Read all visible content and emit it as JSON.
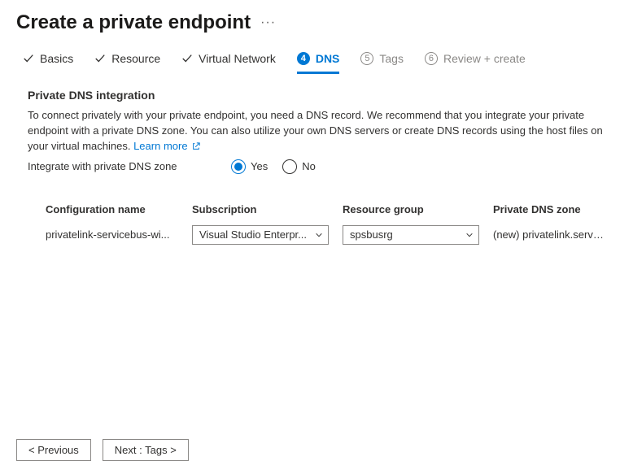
{
  "header": {
    "title": "Create a private endpoint"
  },
  "tabs": {
    "basics": "Basics",
    "resource": "Resource",
    "virtual_network": "Virtual Network",
    "dns_step": "4",
    "dns": "DNS",
    "tags_step": "5",
    "tags": "Tags",
    "review_step": "6",
    "review": "Review + create"
  },
  "section": {
    "title": "Private DNS integration",
    "description": "To connect privately with your private endpoint, you need a DNS record. We recommend that you integrate your private endpoint with a private DNS zone. You can also utilize your own DNS servers or create DNS records using the host files on your virtual machines.",
    "learn_more": "Learn more",
    "integrate_label": "Integrate with private DNS zone",
    "radio_yes": "Yes",
    "radio_no": "No"
  },
  "table": {
    "headers": {
      "config": "Configuration name",
      "subscription": "Subscription",
      "resource_group": "Resource group",
      "dns_zone": "Private DNS zone"
    },
    "row": {
      "config_name": "privatelink-servicebus-wi...",
      "subscription": "Visual Studio Enterpr...",
      "resource_group": "spsbusrg",
      "dns_zone": "(new) privatelink.serviceb..."
    }
  },
  "footer": {
    "previous": "< Previous",
    "next": "Next : Tags >"
  }
}
